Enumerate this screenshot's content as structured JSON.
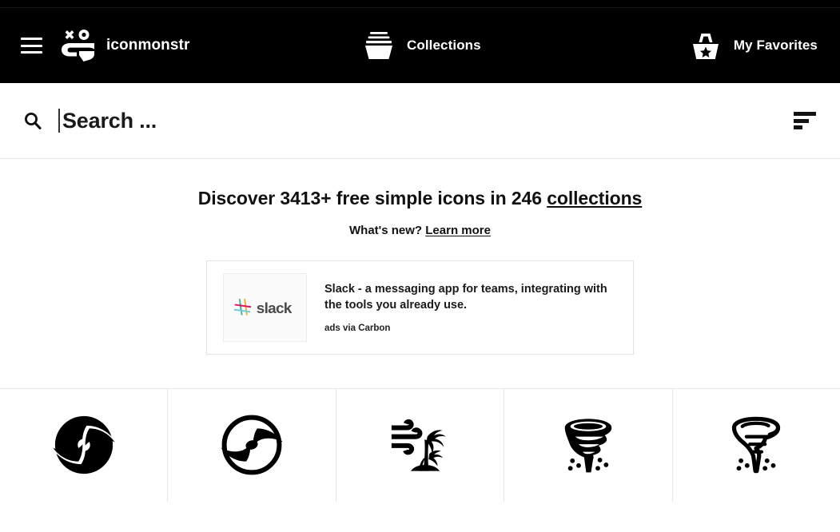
{
  "brand": {
    "name": "iconmonstr",
    "logo_icon": "monster-face-logo-icon",
    "menu_icon": "hamburger-menu-icon"
  },
  "topnav": {
    "collections": {
      "label": "Collections",
      "icon": "basket-stack-icon"
    },
    "favorites": {
      "label": "My Favorites",
      "icon": "basket-star-icon"
    },
    "background_color": "#000000",
    "text_color": "#ffffff"
  },
  "search": {
    "icon": "search-magnifier-icon",
    "value": "",
    "placeholder": "Search ...",
    "filter_icon": "filter-sort-icon"
  },
  "hero": {
    "title_prefix": "Discover 3413+ free simple icons in 246 ",
    "title_link": "collections",
    "icon_count": "3413+",
    "collection_count": "246",
    "subtitle_prefix": "What's new? ",
    "subtitle_link": "Learn more"
  },
  "ad": {
    "logo_alt": "slack",
    "logo_text": "slack",
    "headline": "Slack - a messaging app for teams, integrating with the tools you already use.",
    "source": "ads via Carbon",
    "logo_colors": {
      "green": "#3eb991",
      "pink": "#e01563",
      "yellow": "#ecb22e",
      "blue": "#70cadb",
      "wordmark": "#4a4a4a"
    }
  },
  "icon_grid": [
    {
      "name": "hurricane-filled-icon",
      "label": "Hurricane 1"
    },
    {
      "name": "hurricane-outline-icon",
      "label": "Hurricane 2"
    },
    {
      "name": "wind-palm-tree-icon",
      "label": "Wind Palm Tree"
    },
    {
      "name": "tornado-filled-icon",
      "label": "Tornado 1"
    },
    {
      "name": "tornado-outline-icon",
      "label": "Tornado 2"
    }
  ]
}
